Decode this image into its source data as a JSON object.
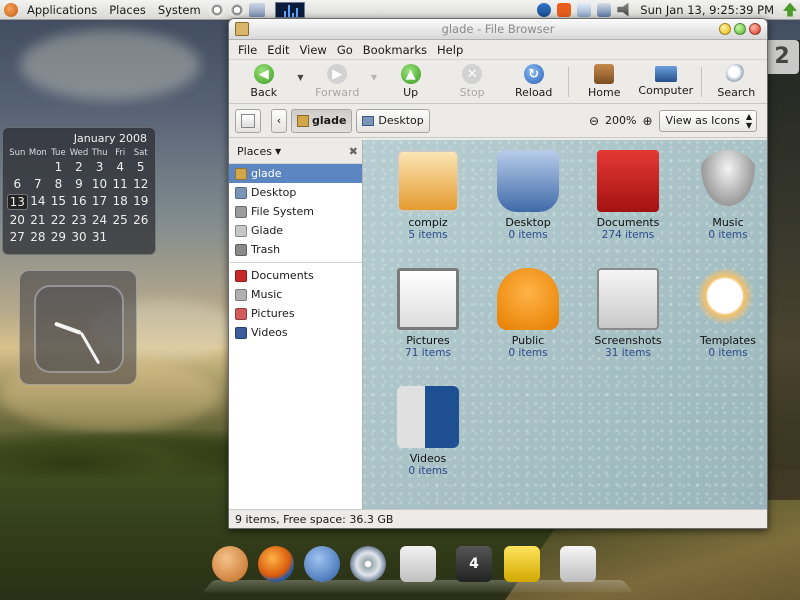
{
  "top_panel": {
    "menus": [
      "Applications",
      "Places",
      "System"
    ],
    "datetime": "Sun Jan 13,  9:25:39 PM"
  },
  "calendar": {
    "title": "January 2008",
    "weekdays": [
      "Sun",
      "Mon",
      "Tue",
      "Wed",
      "Thu",
      "Fri",
      "Sat"
    ],
    "days": [
      "",
      "",
      "1",
      "2",
      "3",
      "4",
      "5",
      "6",
      "7",
      "8",
      "9",
      "10",
      "11",
      "12",
      "13",
      "14",
      "15",
      "16",
      "17",
      "18",
      "19",
      "20",
      "21",
      "22",
      "23",
      "24",
      "25",
      "26",
      "27",
      "28",
      "29",
      "30",
      "31",
      "",
      "",
      ""
    ],
    "today": "13"
  },
  "workspace_badge": "2",
  "window": {
    "title": "glade - File Browser",
    "menu": [
      "File",
      "Edit",
      "View",
      "Go",
      "Bookmarks",
      "Help"
    ],
    "toolbar": {
      "back": "Back",
      "forward": "Forward",
      "up": "Up",
      "stop": "Stop",
      "reload": "Reload",
      "home": "Home",
      "computer": "Computer",
      "search": "Search"
    },
    "location": {
      "path_current": "glade",
      "path_desktop": "Desktop",
      "zoom_level": "200%",
      "view_mode": "View as Icons"
    },
    "sidebar": {
      "header": "Places",
      "items": [
        {
          "label": "glade",
          "color": "#d4a64a"
        },
        {
          "label": "Desktop",
          "color": "#7a95b8"
        },
        {
          "label": "File System",
          "color": "#9c9c9c"
        },
        {
          "label": "Glade",
          "color": "#c7c7c7"
        },
        {
          "label": "Trash",
          "color": "#8a8a8a"
        },
        {
          "label": "Documents",
          "color": "#c62828"
        },
        {
          "label": "Music",
          "color": "#b0b0b0"
        },
        {
          "label": "Pictures",
          "color": "#d35b5b"
        },
        {
          "label": "Videos",
          "color": "#3b5b9a"
        }
      ]
    },
    "files": [
      {
        "name": "compiz",
        "count": "5 items"
      },
      {
        "name": "Desktop",
        "count": "0 items"
      },
      {
        "name": "Documents",
        "count": "274 items"
      },
      {
        "name": "Music",
        "count": "0 items"
      },
      {
        "name": "Pictures",
        "count": "71 items"
      },
      {
        "name": "Public",
        "count": "0 items"
      },
      {
        "name": "Screenshots",
        "count": "31 items"
      },
      {
        "name": "Templates",
        "count": "0 items"
      },
      {
        "name": "Videos",
        "count": "0 items"
      }
    ],
    "status": "9 items, Free space: 36.3 GB"
  },
  "dock": {
    "items": [
      "nautilus-shell-icon",
      "firefox-icon",
      "thunderbird-icon",
      "cd-player-icon",
      "bag-icon",
      "workspace-icon",
      "trash-icon",
      "drive-icon"
    ],
    "workspace_number": "4"
  }
}
